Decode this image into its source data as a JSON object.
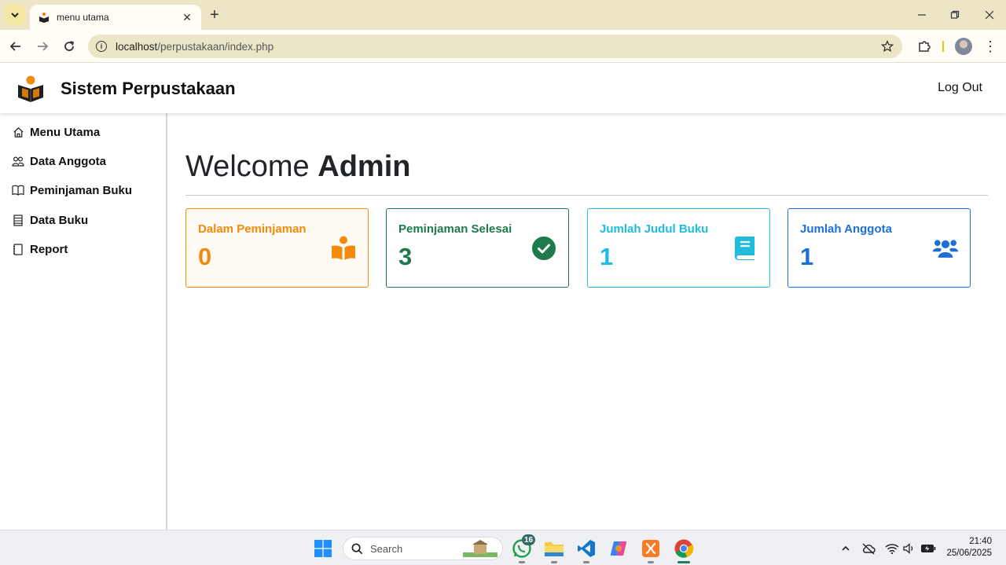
{
  "browser": {
    "tab_title": "menu utama",
    "url_host": "localhost",
    "url_path": "/perpustakaan/index.php"
  },
  "app": {
    "brand": "Sistem Perpustakaan",
    "logout_label": "Log Out"
  },
  "sidebar": {
    "items": [
      {
        "label": "Menu Utama",
        "icon": "home-icon"
      },
      {
        "label": "Data Anggota",
        "icon": "people-icon"
      },
      {
        "label": "Peminjaman Buku",
        "icon": "book-open-icon"
      },
      {
        "label": "Data Buku",
        "icon": "list-icon"
      },
      {
        "label": "Report",
        "icon": "report-icon"
      }
    ]
  },
  "main": {
    "welcome_prefix": "Welcome",
    "welcome_name": "Admin",
    "cards": [
      {
        "title": "Dalam Peminjaman",
        "value": "0",
        "color": "#f28a0c",
        "bg": "#fffaf3",
        "icon": "open-book-reader-icon"
      },
      {
        "title": "Peminjaman Selesai",
        "value": "3",
        "color": "#1e7a4c",
        "bg": "#ffffff",
        "icon": "check-circle-icon"
      },
      {
        "title": "Jumlah Judul Buku",
        "value": "1",
        "color": "#1ebde0",
        "bg": "#ffffff",
        "icon": "book-icon"
      },
      {
        "title": "Jumlah Anggota",
        "value": "1",
        "color": "#1d6fd8",
        "bg": "#ffffff",
        "icon": "users-icon"
      }
    ]
  },
  "taskbar": {
    "search_placeholder": "Search",
    "whatsapp_badge": "16",
    "time": "21:40",
    "date": "25/06/2025"
  }
}
